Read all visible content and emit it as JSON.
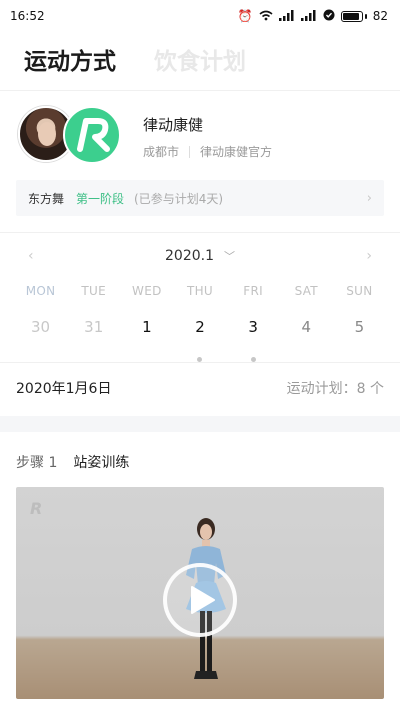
{
  "status": {
    "time": "16:52",
    "battery": "82"
  },
  "tabs": [
    {
      "label": "运动方式",
      "active": true
    },
    {
      "label": "饮食计划",
      "active": false
    }
  ],
  "profile": {
    "name": "律动康健",
    "city": "成都市",
    "official": "律动康健官方"
  },
  "plan": {
    "dance": "东方舞",
    "stage": "第一阶段",
    "joined": "(已参与计划4天)"
  },
  "calendar": {
    "month": "2020.1",
    "weekdays": [
      "MON",
      "TUE",
      "WED",
      "THU",
      "FRI",
      "SAT",
      "SUN"
    ],
    "days": [
      "30",
      "31",
      "1",
      "2",
      "3",
      "4",
      "5"
    ]
  },
  "summary": {
    "date": "2020年1月6日",
    "plan_count": "运动计划：8 个"
  },
  "step": {
    "number": "步骤 1",
    "title": "站姿训练"
  },
  "colors": {
    "accent": "#3dbf86",
    "logo": "#3ccf8e"
  }
}
